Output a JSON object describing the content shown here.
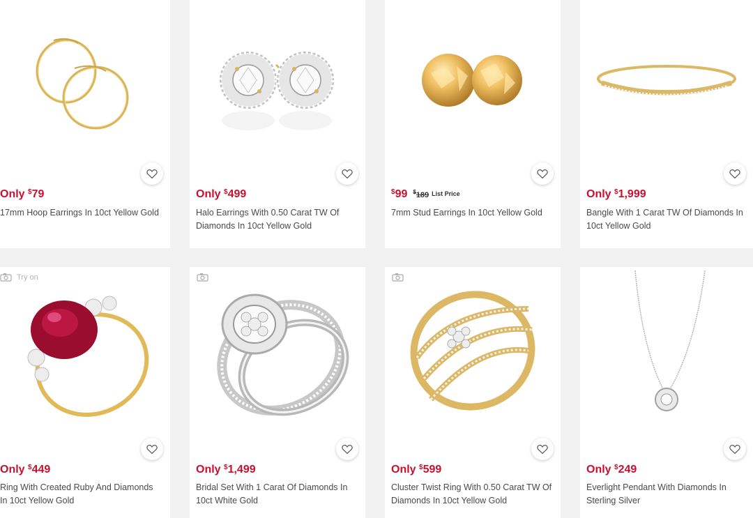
{
  "products": [
    {
      "price_label": "Only",
      "currency": "$",
      "price": "79",
      "name": "17mm Hoop Earrings In 10ct Yellow Gold",
      "wishlist_icon": "heart-outline-icon"
    },
    {
      "price_label": "Only",
      "currency": "$",
      "price": "499",
      "name": "Halo Earrings With 0.50 Carat TW Of Diamonds In 10ct Yellow Gold",
      "wishlist_icon": "heart-outline-icon"
    },
    {
      "price_label": "",
      "currency": "$",
      "price": "99",
      "was_currency": "$",
      "was_price": "189",
      "list_label": "List Price",
      "name": "7mm Stud Earrings In 10ct Yellow Gold",
      "wishlist_icon": "heart-outline-icon"
    },
    {
      "price_label": "Only",
      "currency": "$",
      "price": "1,999",
      "name": "Bangle With 1 Carat TW Of Diamonds In 10ct Yellow Gold",
      "wishlist_icon": "heart-outline-icon"
    },
    {
      "price_label": "Only",
      "currency": "$",
      "price": "449",
      "name": "Ring With Created Ruby And Diamonds In 10ct Yellow Gold",
      "try_on": "Try on",
      "wishlist_icon": "heart-outline-icon"
    },
    {
      "price_label": "Only",
      "currency": "$",
      "price": "1,499",
      "name": "Bridal Set With 1 Carat Of Diamonds In 10ct White Gold",
      "wishlist_icon": "heart-outline-icon"
    },
    {
      "price_label": "Only",
      "currency": "$",
      "price": "599",
      "name": "Cluster Twist Ring With 0.50 Carat TW Of Diamonds In 10ct Yellow Gold",
      "wishlist_icon": "heart-outline-icon"
    },
    {
      "price_label": "Only",
      "currency": "$",
      "price": "249",
      "name": "Everlight Pendant With Diamonds In Sterling Silver",
      "wishlist_icon": "heart-outline-icon"
    }
  ],
  "colors": {
    "price": "#c8102e",
    "text": "#4a4a4a",
    "background": "#f2f2f2",
    "card": "#ffffff"
  }
}
